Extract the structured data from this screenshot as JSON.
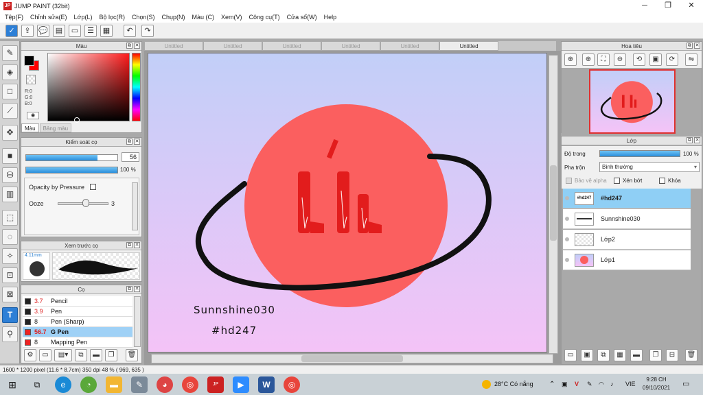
{
  "window": {
    "title": "JUMP PAINT (32bit)",
    "app_icon": "JP"
  },
  "menu": [
    "Tệp(F)",
    "Chỉnh sửa(E)",
    "Lớp(L)",
    "Bộ lọc(R)",
    "Chọn(S)",
    "Chụp(N)",
    "Màu (C)",
    "Xem(V)",
    "Công cụ(T)",
    "Cửa sổ(W)",
    "Help"
  ],
  "color_panel": {
    "title": "Màu",
    "rgb": [
      "R:0",
      "G:0",
      "B:0"
    ],
    "tabs": [
      "Màu",
      "Bảng màu"
    ],
    "primary_color": "#000000",
    "secondary_color": "#ff0000"
  },
  "brush_control": {
    "title": "Kiểm soát cọ",
    "size_value": "56",
    "size_fraction": 0.78,
    "opacity_label": "100 %",
    "opacity_fraction": 1.0,
    "opacity_by_pressure": "Opacity by Pressure",
    "ooze_label": "Ooze",
    "ooze_value": "3",
    "ooze_fraction": 0.55
  },
  "brush_preview": {
    "title": "Xem trước cọ",
    "size": "4.11mm"
  },
  "brush_list": {
    "title": "Cọ",
    "items": [
      {
        "size": "3.7",
        "name": "Pencil",
        "color": "#222222"
      },
      {
        "size": "3.9",
        "name": "Pen",
        "color": "#222222"
      },
      {
        "size": "8",
        "name": "Pen (Sharp)",
        "color": "#222222"
      },
      {
        "size": "56.7",
        "name": "G Pen",
        "color": "#e22222"
      },
      {
        "size": "8",
        "name": "Mapping Pen",
        "color": "#e22222"
      }
    ],
    "selected_index": 3
  },
  "tabs": [
    "Untitled",
    "Untitled",
    "Untitled",
    "Untitled",
    "Untitled",
    "Untitled"
  ],
  "canvas": {
    "glyphs": "ú li",
    "text_line1": "Sunnshine030",
    "text_line2": "#hd247",
    "circle_color": "#fb5f5f",
    "ring_color": "#111111"
  },
  "navigator": {
    "title": "Hoa tiêu"
  },
  "layers": {
    "title": "Lớp",
    "opacity_label": "Độ trong",
    "opacity_value": "100 %",
    "blend_label": "Pha trộn",
    "blend_value": "Bình thường",
    "protect_alpha": "Bảo vệ alpha",
    "clipping": "Xén bớt",
    "lock": "Khóa",
    "items": [
      {
        "name": "#hd247",
        "thumb": "#hd247",
        "selected": true
      },
      {
        "name": "Sunnshine030",
        "thumb": "",
        "selected": false
      },
      {
        "name": "Lớp2",
        "thumb": "",
        "selected": false
      },
      {
        "name": "Lớp1",
        "thumb": "",
        "selected": false
      }
    ]
  },
  "status": "1600 * 1200 pixel   (11.6 * 8.7cm)   350 dpi   48 %   ( 969, 635 )",
  "taskbar": {
    "weather": "28°C Có nắng",
    "language": "VIE",
    "time": "9:28 CH",
    "date": "09/10/2021"
  }
}
